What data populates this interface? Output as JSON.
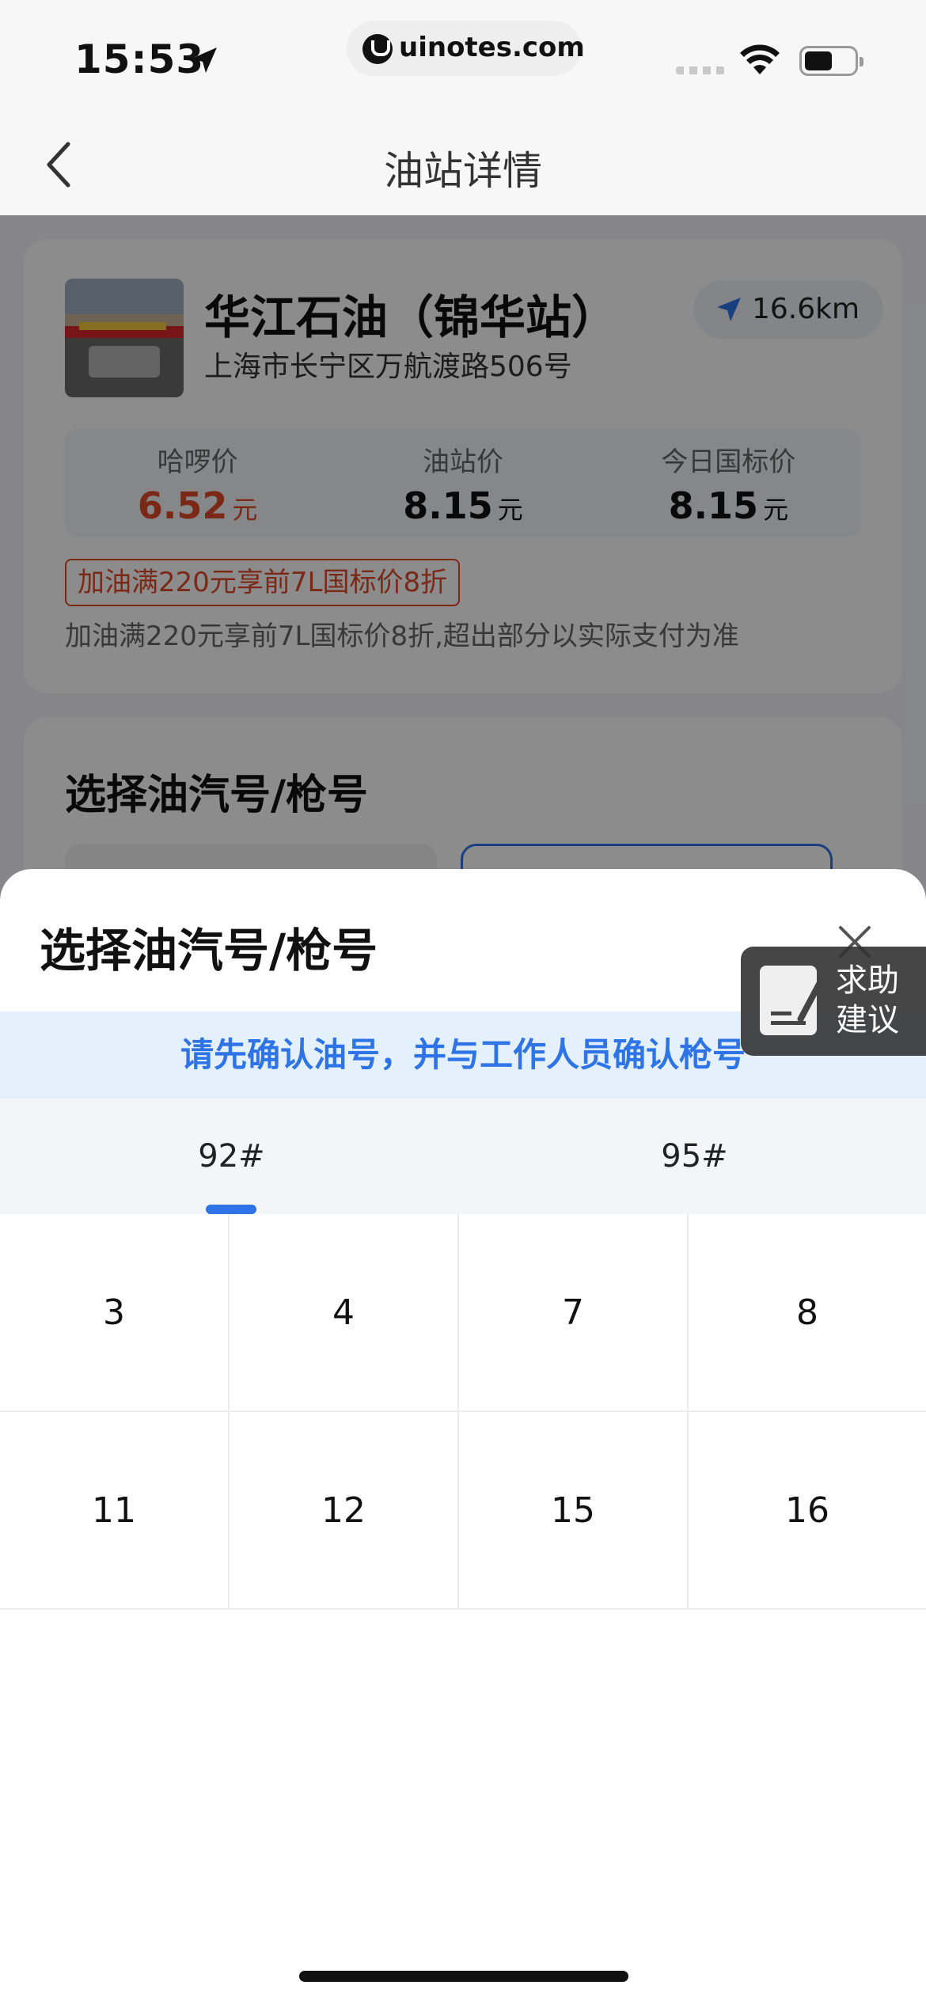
{
  "status_bar": {
    "time": "15:53",
    "url": "uinotes.com"
  },
  "nav": {
    "title": "油站详情"
  },
  "station": {
    "name": "华江石油（锦华站）",
    "address": "上海市长宁区万航渡路506号",
    "distance": "16.6km",
    "prices": [
      {
        "label": "哈啰价",
        "value": "6.52",
        "unit": "元",
        "highlight": true
      },
      {
        "label": "油站价",
        "value": "8.15",
        "unit": "元",
        "highlight": false
      },
      {
        "label": "今日国标价",
        "value": "8.15",
        "unit": "元",
        "highlight": false
      }
    ],
    "promo_tag": "加油满220元享前7L国标价8折",
    "promo_desc": "加油满220元享前7L国标价8折,超出部分以实际支付为准"
  },
  "background_section": {
    "title": "选择油汽号/枪号"
  },
  "sheet": {
    "title": "选择油汽号/枪号",
    "notice": "请先确认油号，并与工作人员确认枪号",
    "tabs": [
      {
        "label": "92#",
        "active": true
      },
      {
        "label": "95#",
        "active": false
      }
    ],
    "guns": [
      "3",
      "4",
      "7",
      "8",
      "11",
      "12",
      "15",
      "16"
    ]
  },
  "help": {
    "label_line1": "求助",
    "label_line2": "建议"
  },
  "colors": {
    "accent": "#2f74e6",
    "price_red": "#e0492a",
    "notice_bg": "#e4f0fc"
  }
}
